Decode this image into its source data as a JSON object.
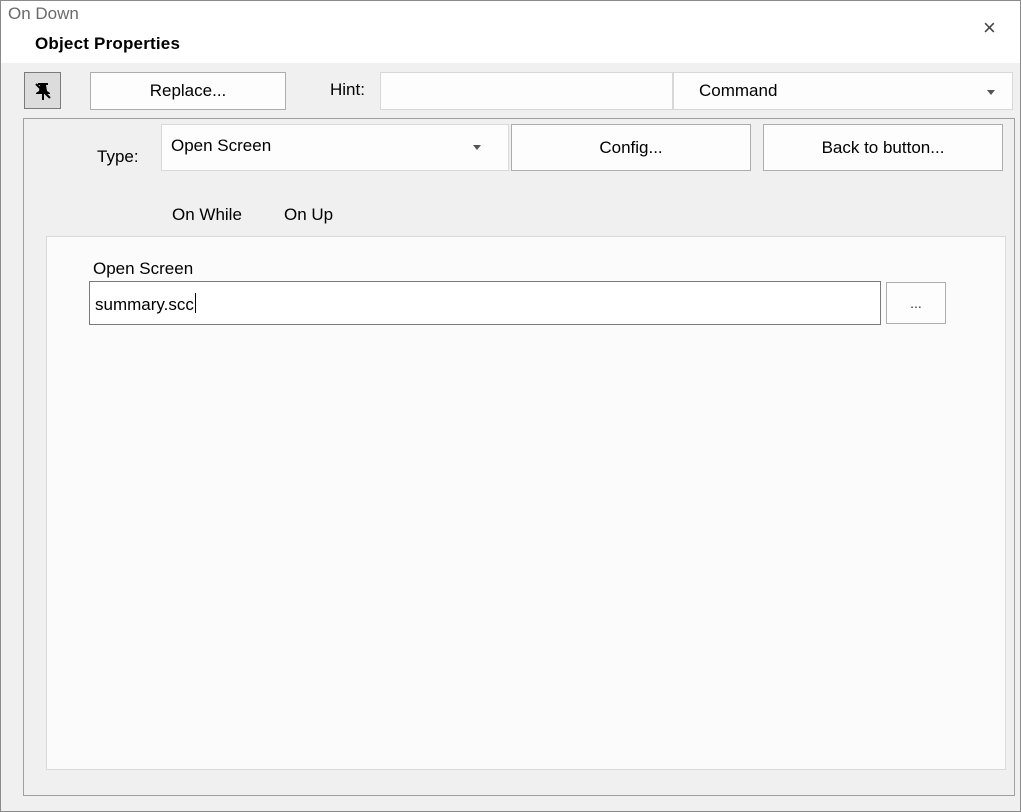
{
  "window": {
    "title": "Object Properties",
    "close_glyph": "×"
  },
  "toolbar": {
    "pin_icon": "pushpin-icon",
    "replace_label": "Replace...",
    "hint_label": "Hint:",
    "hint_value": "",
    "mode_value": "Command"
  },
  "type_row": {
    "type_label": "Type:",
    "type_value": "Open Screen",
    "config_label": "Config...",
    "back_label": "Back to button..."
  },
  "tabs": [
    {
      "label": "On Down",
      "active": true
    },
    {
      "label": "On While",
      "active": false
    },
    {
      "label": "On Up",
      "active": false
    }
  ],
  "open_screen": {
    "label": "Open Screen",
    "value": "summary.scc",
    "browse_label": "..."
  }
}
